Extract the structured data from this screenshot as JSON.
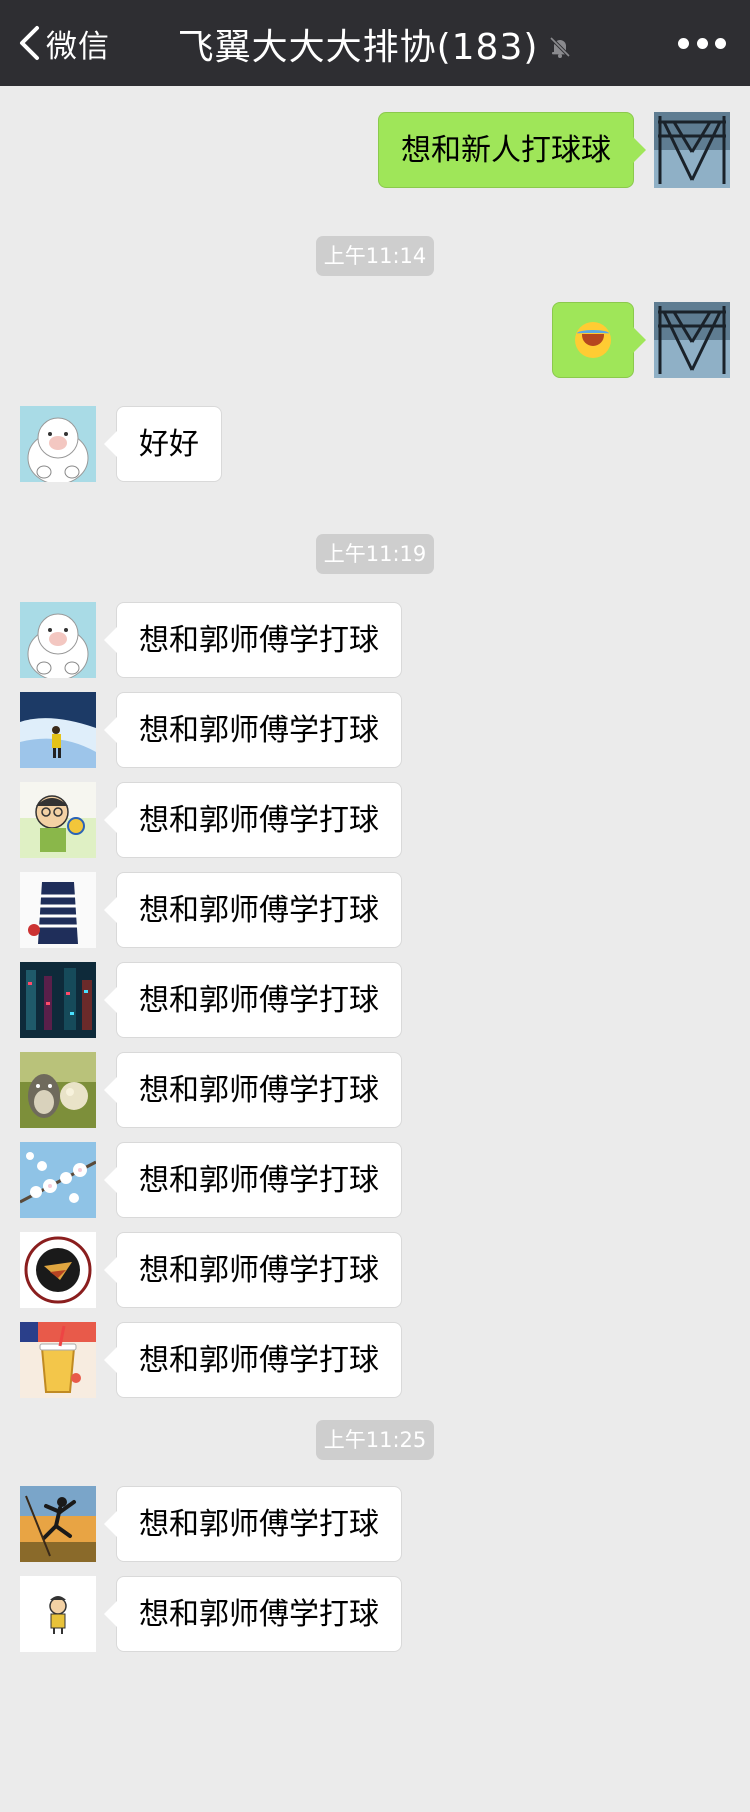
{
  "nav": {
    "back_label": "微信",
    "title": "飞翼大大大排协(183)",
    "mute_icon": "bell-slash-icon",
    "more_icon": "more-dots-icon"
  },
  "colors": {
    "nav_bg": "#2e2e32",
    "chat_bg": "#ebebeb",
    "bubble_self": "#9fe659",
    "bubble_other": "#ffffff",
    "timestamp_bg": "#cecece"
  },
  "messages": [
    {
      "kind": "message",
      "side": "right",
      "text": "想和新人打球球",
      "avatar": "steel-structure-avatar"
    },
    {
      "kind": "time",
      "text": "上午11:14"
    },
    {
      "kind": "message",
      "side": "right",
      "text": "",
      "emoji": "laughing-crying-emoji",
      "avatar": "steel-structure-avatar"
    },
    {
      "kind": "message",
      "side": "left",
      "text": "好好",
      "avatar": "polar-bear-avatar"
    },
    {
      "kind": "time",
      "text": "上午11:19"
    },
    {
      "kind": "message",
      "side": "left",
      "text": "想和郭师傅学打球",
      "avatar": "polar-bear-avatar"
    },
    {
      "kind": "message",
      "side": "left",
      "text": "想和郭师傅学打球",
      "avatar": "snow-hiker-avatar"
    },
    {
      "kind": "message",
      "side": "left",
      "text": "想和郭师傅学打球",
      "avatar": "volleyball-cartoon-avatar"
    },
    {
      "kind": "message",
      "side": "left",
      "text": "想和郭师傅学打球",
      "avatar": "striped-shirt-avatar"
    },
    {
      "kind": "message",
      "side": "left",
      "text": "想和郭师傅学打球",
      "avatar": "neon-city-avatar"
    },
    {
      "kind": "message",
      "side": "left",
      "text": "想和郭师傅学打球",
      "avatar": "totoro-avatar"
    },
    {
      "kind": "message",
      "side": "left",
      "text": "想和郭师傅学打球",
      "avatar": "cherry-blossom-avatar"
    },
    {
      "kind": "message",
      "side": "left",
      "text": "想和郭师傅学打球",
      "avatar": "university-seal-avatar"
    },
    {
      "kind": "message",
      "side": "left",
      "text": "想和郭师傅学打球",
      "avatar": "drink-cup-avatar"
    },
    {
      "kind": "time",
      "text": "上午11:25"
    },
    {
      "kind": "message",
      "side": "left",
      "text": "想和郭师傅学打球",
      "avatar": "sunset-jumper-avatar"
    },
    {
      "kind": "message",
      "side": "left",
      "text": "想和郭师傅学打球",
      "avatar": "small-cartoon-avatar"
    }
  ]
}
